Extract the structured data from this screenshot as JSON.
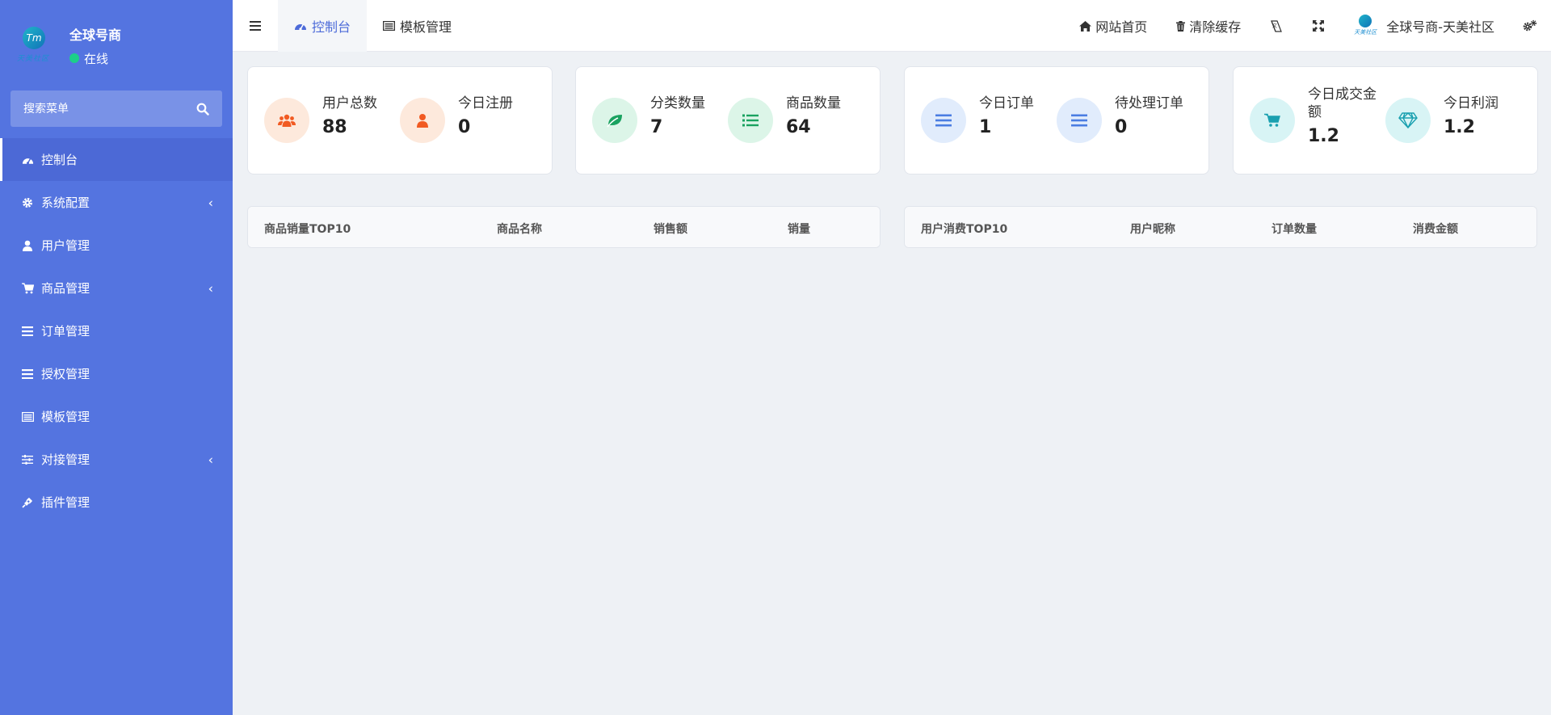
{
  "sidebar": {
    "user_name": "全球号商",
    "status": "在线",
    "search_placeholder": "搜索菜单",
    "items": [
      {
        "label": "控制台",
        "icon": "dashboard-icon",
        "active": true,
        "has_arrow": false
      },
      {
        "label": "系统配置",
        "icon": "gear-icon",
        "active": false,
        "has_arrow": true
      },
      {
        "label": "用户管理",
        "icon": "user-icon",
        "active": false,
        "has_arrow": false
      },
      {
        "label": "商品管理",
        "icon": "cart-icon",
        "active": false,
        "has_arrow": true
      },
      {
        "label": "订单管理",
        "icon": "list-icon",
        "active": false,
        "has_arrow": false
      },
      {
        "label": "授权管理",
        "icon": "list-icon",
        "active": false,
        "has_arrow": false
      },
      {
        "label": "模板管理",
        "icon": "template-icon",
        "active": false,
        "has_arrow": false
      },
      {
        "label": "对接管理",
        "icon": "sliders-icon",
        "active": false,
        "has_arrow": true
      },
      {
        "label": "插件管理",
        "icon": "plug-icon",
        "active": false,
        "has_arrow": false
      }
    ]
  },
  "header": {
    "tabs": [
      {
        "label": "控制台",
        "icon": "dashboard-icon",
        "active": true
      },
      {
        "label": "模板管理",
        "icon": "template-icon",
        "active": false
      }
    ],
    "site_home": "网站首页",
    "clear_cache": "清除缓存",
    "user_display": "全球号商-天美社区"
  },
  "stats": [
    {
      "label": "用户总数",
      "value": "88",
      "icon": "users-icon",
      "color": "#f15a22",
      "bg": "#fde9dc"
    },
    {
      "label": "今日注册",
      "value": "0",
      "icon": "user-icon",
      "color": "#f15a22",
      "bg": "#fde9dc"
    },
    {
      "label": "分类数量",
      "value": "7",
      "icon": "leaf-icon",
      "color": "#1aa260",
      "bg": "#dcf5e8"
    },
    {
      "label": "商品数量",
      "value": "64",
      "icon": "list-icon",
      "color": "#1aa260",
      "bg": "#dcf5e8"
    },
    {
      "label": "今日订单",
      "value": "1",
      "icon": "bars-icon",
      "color": "#4a7de2",
      "bg": "#e1ecfc"
    },
    {
      "label": "待处理订单",
      "value": "0",
      "icon": "bars-icon",
      "color": "#4a7de2",
      "bg": "#e1ecfc"
    },
    {
      "label": "今日成交金额",
      "value": "1.2",
      "icon": "cart-icon",
      "color": "#1aa0b0",
      "bg": "#d8f4f5"
    },
    {
      "label": "今日利润",
      "value": "1.2",
      "icon": "diamond-icon",
      "color": "#1aa0b0",
      "bg": "#d8f4f5"
    }
  ],
  "tables": {
    "products": {
      "headers": [
        "商品销量TOP10",
        "商品名称",
        "销售额",
        "销量"
      ]
    },
    "users": {
      "headers": [
        "用户消费TOP10",
        "用户昵称",
        "订单数量",
        "消费金额"
      ]
    }
  },
  "colors": {
    "sidebar_bg": "#5474e0",
    "accent": "#4d6bd9",
    "online": "#1ccf89"
  }
}
